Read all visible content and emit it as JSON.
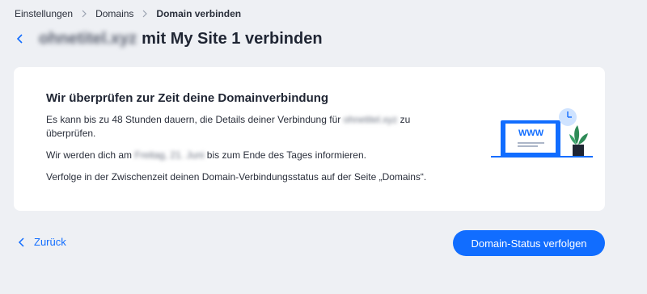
{
  "breadcrumb": {
    "items": [
      "Einstellungen",
      "Domains",
      "Domain verbinden"
    ]
  },
  "header": {
    "domain_name": "ohnetitel.xyz",
    "title": "mit My Site 1 verbinden"
  },
  "card": {
    "heading": "Wir überprüfen zur Zeit deine Domainverbindung",
    "line1_prefix": "Es kann bis zu 48 Stunden dauern, die Details deiner Verbindung für",
    "line1_domain": "ohnetitel.xyz",
    "line1_suffix": "zu überprüfen.",
    "line2_prefix": "Wir werden dich am",
    "line2_date": "Freitag, 21. Juni",
    "line2_suffix": "bis zum Ende des Tages informieren.",
    "line3": "Verfolge in der Zwischenzeit deinen Domain-Verbindungsstatus auf der Seite „Domains“.",
    "illustration_text": "WWW"
  },
  "footer": {
    "back_label": "Zurück",
    "primary_label": "Domain-Status verfolgen"
  },
  "colors": {
    "accent": "#116dff",
    "background": "#eef0f4",
    "card": "#ffffff",
    "text": "#1f2533"
  },
  "icons": {
    "back": "chevron-left-icon",
    "separator": "chevron-right-icon",
    "illustration": "browser-www-clock-plant-illustration"
  }
}
